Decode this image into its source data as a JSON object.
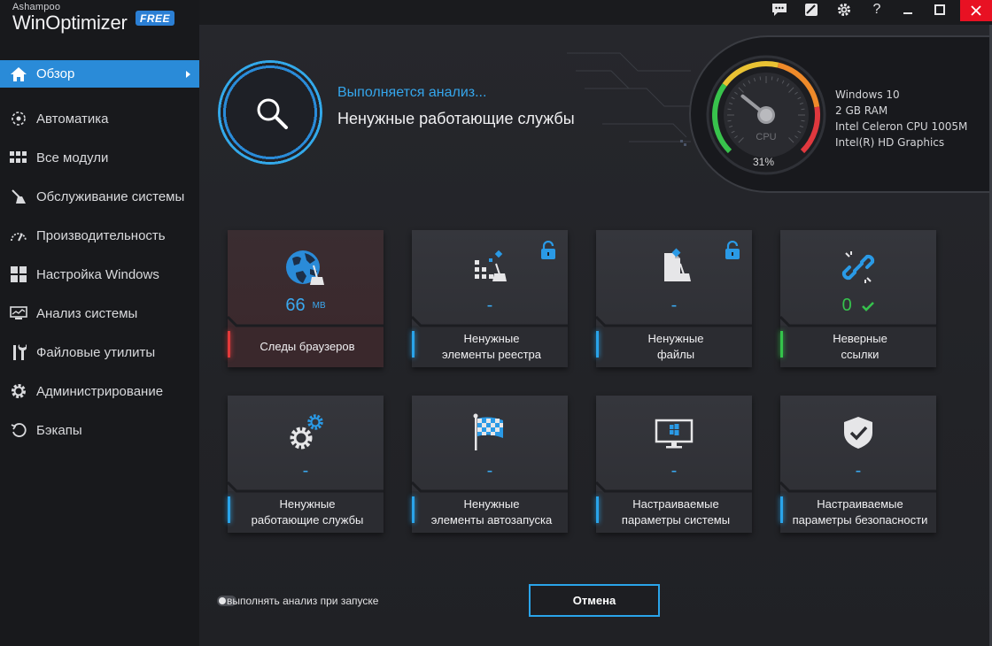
{
  "app": {
    "vendor": "Ashampoo",
    "name": "WinOptimizer",
    "badge": "FREE"
  },
  "window_controls": [
    "feedback-icon",
    "skin-icon",
    "gear-icon",
    "help-icon",
    "minimize-icon",
    "maximize-icon",
    "close-icon"
  ],
  "window_controls_labels": {
    "help": "?"
  },
  "sidebar": {
    "items": [
      {
        "label": "Обзор",
        "icon": "home-icon",
        "active": true
      },
      {
        "label": "Автоматика",
        "icon": "automation-icon"
      },
      {
        "label": "Все модули",
        "icon": "grid-icon"
      },
      {
        "label": "Обслуживание системы",
        "icon": "broom-icon"
      },
      {
        "label": "Производительность",
        "icon": "speedometer-icon"
      },
      {
        "label": "Настройка Windows",
        "icon": "windows-icon"
      },
      {
        "label": "Анализ системы",
        "icon": "monitor-chart-icon"
      },
      {
        "label": "Файловые утилиты",
        "icon": "tools-icon"
      },
      {
        "label": "Администрирование",
        "icon": "gear-icon"
      },
      {
        "label": "Бэкапы",
        "icon": "backup-icon"
      }
    ]
  },
  "scan": {
    "status": "Выполняется анализ...",
    "current": "Ненужные работающие службы"
  },
  "gauge": {
    "label": "CPU",
    "percent_text": "31%",
    "percent": 31
  },
  "system_info": [
    "Windows 10",
    "2 GB RAM",
    "Intel Celeron CPU 1005M",
    "Intel(R) HD Graphics"
  ],
  "tiles": [
    {
      "label1": "Следы браузеров",
      "label2": "",
      "value": "66",
      "unit": "MB",
      "accent": "red",
      "icon": "globe-broom-icon",
      "locked": false
    },
    {
      "label1": "Ненужные",
      "label2": "элементы реестра",
      "value": "-",
      "unit": "",
      "accent": "blue",
      "icon": "registry-broom-icon",
      "locked": true
    },
    {
      "label1": "Ненужные",
      "label2": "файлы",
      "value": "-",
      "unit": "",
      "accent": "blue",
      "icon": "file-broom-icon",
      "locked": true
    },
    {
      "label1": "Неверные",
      "label2": "ссылки",
      "value": "0",
      "unit": "",
      "accent": "green",
      "icon": "broken-link-icon",
      "locked": false
    },
    {
      "label1": "Ненужные",
      "label2": "работающие службы",
      "value": "-",
      "unit": "",
      "accent": "blue",
      "icon": "services-gears-icon",
      "locked": false
    },
    {
      "label1": "Ненужные",
      "label2": "элементы автозапуска",
      "value": "-",
      "unit": "",
      "accent": "blue",
      "icon": "checkered-flag-icon",
      "locked": false
    },
    {
      "label1": "Настраиваемые",
      "label2": "параметры системы",
      "value": "-",
      "unit": "",
      "accent": "blue",
      "icon": "windows-monitor-icon",
      "locked": false
    },
    {
      "label1": "Настраиваемые",
      "label2": "параметры безопасности",
      "value": "-",
      "unit": "",
      "accent": "blue",
      "icon": "shield-check-icon",
      "locked": false
    }
  ],
  "footer": {
    "autostart_label": "выполнять анализ при запуске",
    "autostart_on": false,
    "cancel_label": "Отмена"
  },
  "colors": {
    "accent": "#2a8bd8",
    "accent_light": "#35a6ec",
    "red": "#e23a3a",
    "green": "#34c34b",
    "close": "#e81123"
  }
}
